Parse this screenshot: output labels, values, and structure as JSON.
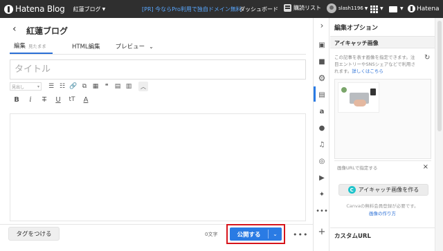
{
  "topbar": {
    "logo": "Hatena Blog",
    "blog_selector": "紅蓮ブログ",
    "pr_link": "[PR] 今ならPro利用で独自ドメイン無料",
    "dashboard": "ダッシュボード",
    "reader": "購読リスト",
    "username": "slash1196",
    "hatena": "Hatena"
  },
  "editor": {
    "blog_title": "紅蓮ブログ",
    "tabs": [
      {
        "label": "編集",
        "sub": "見たまま",
        "active": true
      },
      {
        "label": "HTML編集"
      },
      {
        "label": "プレビュー"
      }
    ],
    "title_placeholder": "タイトル",
    "format_select": "見出し",
    "toolbar_row1": [
      "☰",
      "☷",
      "🔗",
      "⧉",
      "▦",
      "❝",
      "▤",
      "▥"
    ],
    "toolbar_row2": [
      "B",
      "i",
      "T",
      "U",
      "tT",
      "A"
    ],
    "tag_button": "タグをつける",
    "char_count": "0文字",
    "publish_button": "公開する",
    "more": "•••"
  },
  "panel": {
    "title": "編集オプション",
    "eyecatch_heading": "アイキャッチ画像",
    "eyecatch_desc": "この記事を表す画像を指定できます。注目エントリーやSNSシェアなどで利用されます。",
    "eyecatch_link": "詳しくはこちら",
    "url_label": "画像URLで指定する",
    "canva_button": "アイキャッチ画像を作る",
    "canva_note": "Canvaの無料会員登録が必要です。",
    "canva_link": "画像の作り方",
    "custom_url": "カスタムURL"
  },
  "rail_icons": [
    "chevron-right",
    "photo",
    "folder",
    "gear",
    "document",
    "amazon",
    "rakuten",
    "music",
    "instagram",
    "youtube",
    "twitter",
    "more",
    "plus"
  ],
  "colors": {
    "topbar": "#2f2f2f",
    "accent": "#2a7be4",
    "highlight": "#d6141b",
    "canva": "#20c4cb"
  }
}
